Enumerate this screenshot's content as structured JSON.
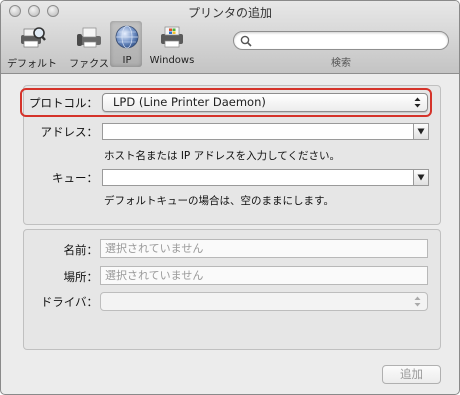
{
  "window": {
    "title": "プリンタの追加"
  },
  "toolbar": {
    "items": [
      {
        "label": "デフォルト",
        "icon": "printer-magnifier-icon"
      },
      {
        "label": "ファクス",
        "icon": "fax-icon"
      },
      {
        "label": "IP",
        "icon": "globe-icon",
        "selected": true
      },
      {
        "label": "Windows",
        "icon": "windows-printer-icon"
      }
    ],
    "search": {
      "placeholder": "",
      "caption": "検索"
    }
  },
  "connection": {
    "protocol_label": "プロトコル：",
    "protocol_value": "LPD (Line Printer Daemon)",
    "address_label": "アドレス：",
    "address_value": "",
    "address_hint": "ホスト名または IP アドレスを入力してください。",
    "queue_label": "キュー：",
    "queue_value": "",
    "queue_hint": "デフォルトキューの場合は、空のままにします。"
  },
  "details": {
    "name_label": "名前：",
    "name_placeholder": "選択されていません",
    "location_label": "場所：",
    "location_placeholder": "選択されていません",
    "driver_label": "ドライバ：",
    "driver_value": ""
  },
  "footer": {
    "add_label": "追加"
  },
  "colors": {
    "focus": "#d5332a",
    "window_bg": "#ececec"
  }
}
